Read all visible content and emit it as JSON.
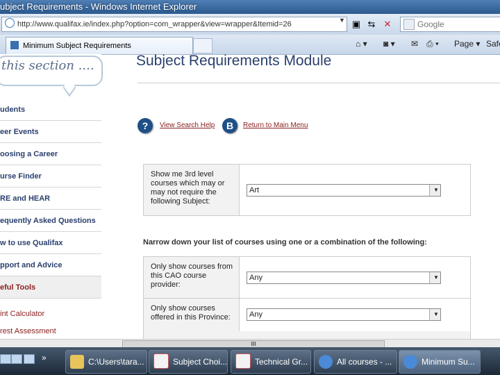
{
  "window": {
    "title": "ubject Requirements - Windows Internet Explorer"
  },
  "address": {
    "url": "http://www.qualifax.ie/index.php?option=com_wrapper&view=wrapper&Itemid=26",
    "search_placeholder": "Google"
  },
  "tab": {
    "label": "Minimum Subject Requirements"
  },
  "commands": {
    "page": "Page",
    "safety": "Safe"
  },
  "banner": {
    "text": "this section ...."
  },
  "nav": {
    "items": [
      {
        "label": "udents"
      },
      {
        "label": "eer Events"
      },
      {
        "label": "oosing a Career"
      },
      {
        "label": "urse Finder"
      },
      {
        "label": "RE and HEAR"
      },
      {
        "label": "equently Asked Questions"
      },
      {
        "label": "w to use Qualifax"
      },
      {
        "label": "pport and Advice"
      },
      {
        "label": "eful Tools"
      }
    ],
    "subitems": [
      {
        "label": "int Calculator"
      },
      {
        "label": "rest Assessment"
      }
    ]
  },
  "main": {
    "heading": "Subject Requirements Module",
    "help_link": "View Search Help",
    "main_menu_link": "Return to Main Menu",
    "subject_label": "Show me 3rd level courses which may or may not require the following Subject:",
    "subject_value": "Art",
    "narrow_text": "Narrow down your list of courses using one or a combination of the following:",
    "filters": [
      {
        "label": "Only show courses from this CAO course provider:",
        "value": "Any"
      },
      {
        "label": "Only show courses offered in this Province:",
        "value": "Any"
      }
    ],
    "scroll_label": "III"
  },
  "taskbar": {
    "items": [
      {
        "label": "C:\\Users\\tara..."
      },
      {
        "label": "Subject Choi..."
      },
      {
        "label": "Technical Gr..."
      },
      {
        "label": "All courses - ..."
      },
      {
        "label": "Minimum Su..."
      }
    ],
    "chevron": "»"
  }
}
